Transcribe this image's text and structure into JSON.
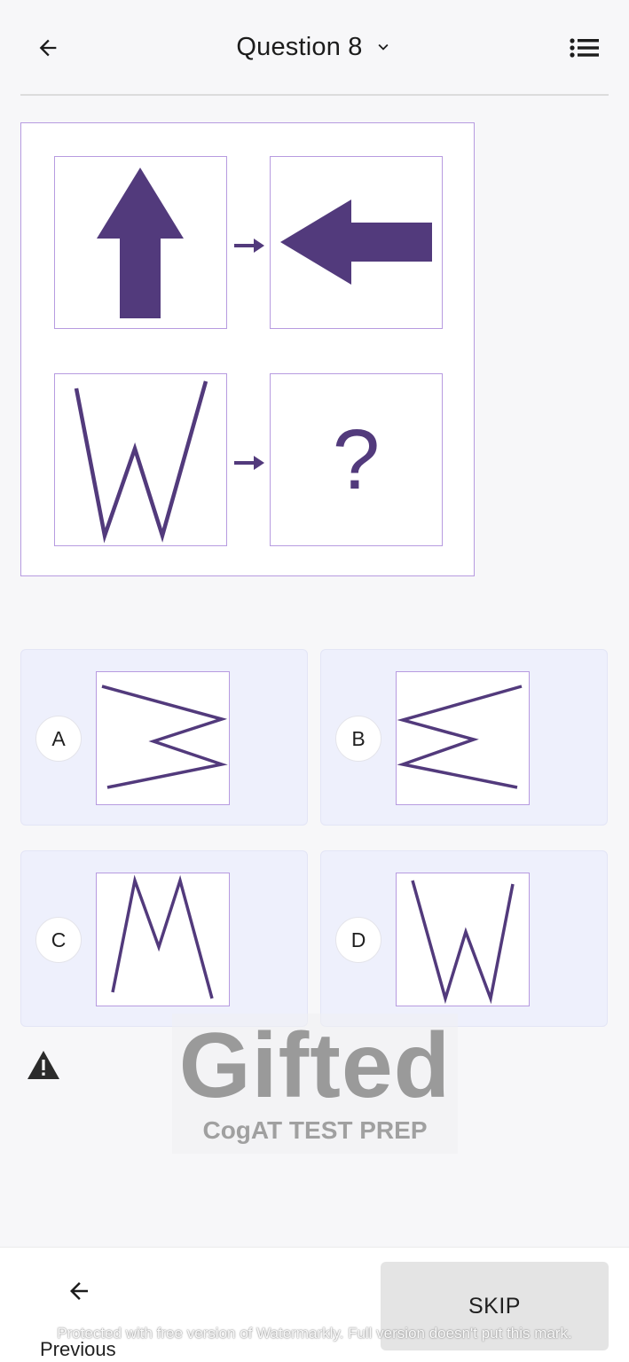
{
  "header": {
    "title": "Question 8",
    "back_icon": "arrow-left-icon",
    "dropdown_icon": "chevron-down-icon",
    "list_icon": "list-icon"
  },
  "question": {
    "top_left": "arrow-up-shape",
    "top_right": "arrow-left-shape",
    "bottom_left": "w-shape",
    "bottom_right_text": "?"
  },
  "answers": [
    {
      "letter": "A",
      "shape": "w-rotated-right"
    },
    {
      "letter": "B",
      "shape": "w-rotated-left"
    },
    {
      "letter": "C",
      "shape": "m-shape"
    },
    {
      "letter": "D",
      "shape": "w-shape"
    }
  ],
  "report_icon": "warning-icon",
  "watermark": {
    "logo_text": "Gifted",
    "logo_subtext": "CogAT TEST PREP",
    "footer_text": "Protected with free version of Watermarkly. Full version doesn't put this mark."
  },
  "bottom": {
    "previous_label": "Previous",
    "skip_label": "SKIP"
  },
  "colors": {
    "accent": "#523a7c",
    "border": "#b79be0",
    "card_bg": "#eef0fc"
  }
}
